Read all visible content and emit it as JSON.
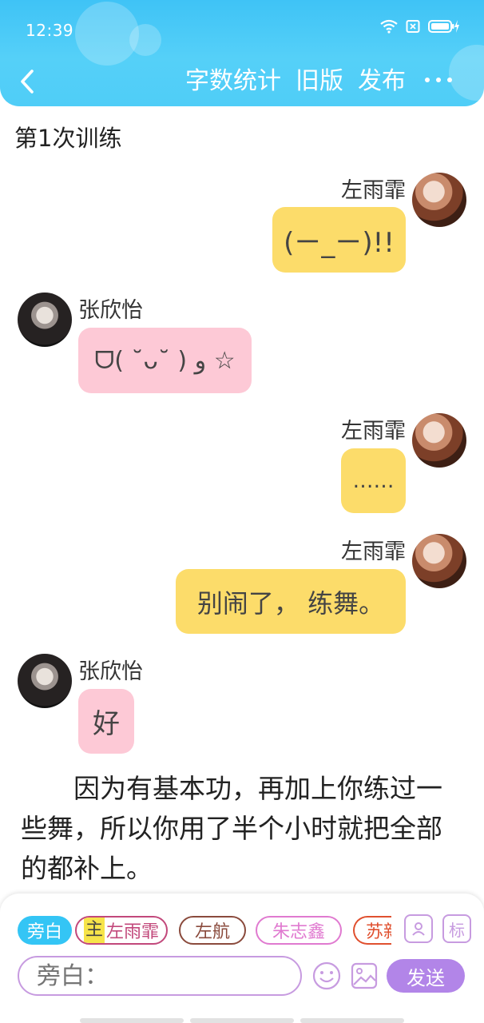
{
  "status_bar": {
    "time": "12:39"
  },
  "navbar": {
    "back_icon": "chevron-left-icon",
    "actions": [
      "字数统计",
      "旧版",
      "发布"
    ],
    "more_icon": "more-dots-icon"
  },
  "session_title": "第1次训练",
  "messages": [
    {
      "side": "right",
      "sender": "左雨霏",
      "text": "(ㄧ_ㄧ)!!"
    },
    {
      "side": "left",
      "sender": "张欣怡",
      "text": "ᗜ( ˘ᴗ˘ ) ﻭ ☆"
    },
    {
      "side": "right",
      "sender": "左雨霏",
      "text": "……"
    },
    {
      "side": "right",
      "sender": "左雨霏",
      "text": "别闹了， 练舞。"
    },
    {
      "side": "left",
      "sender": "张欣怡",
      "text": "好"
    }
  ],
  "narration": "因为有基本功，再加上你练过一些舞，所以你用了半个小时就把全部的都补上。",
  "character_bar": {
    "narrator_label": "旁白",
    "main_tag": "主",
    "characters": [
      "左雨霏",
      "左航",
      "朱志鑫",
      "苏新"
    ],
    "tool_icons": [
      "contact-card-icon",
      "标"
    ]
  },
  "input": {
    "placeholder": "旁白：",
    "send_label": "发送"
  },
  "colors": {
    "header": "#4fcdf7",
    "right_bubble": "#fcdc6a",
    "left_bubble": "#fdc9d6",
    "send_button": "#b285e8",
    "accent_border": "#c79be0"
  }
}
